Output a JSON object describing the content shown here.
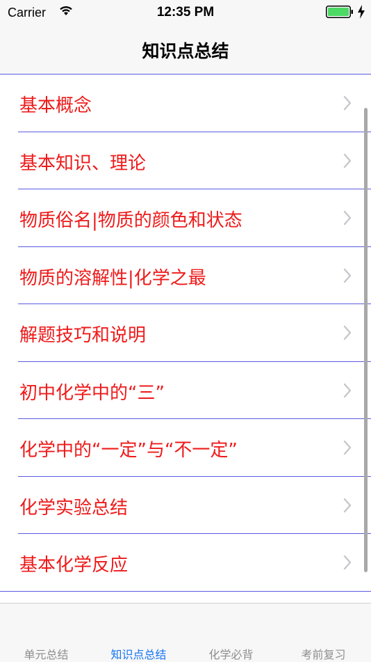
{
  "status_bar": {
    "carrier": "Carrier",
    "time": "12:35 PM"
  },
  "nav": {
    "title": "知识点总结"
  },
  "items": [
    {
      "label": "基本概念"
    },
    {
      "label": "基本知识、理论"
    },
    {
      "label": "物质俗名|物质的颜色和状态"
    },
    {
      "label": "物质的溶解性|化学之最"
    },
    {
      "label": "解题技巧和说明"
    },
    {
      "label": "初中化学中的“三”"
    },
    {
      "label": "化学中的“一定”与“不一定”"
    },
    {
      "label": "化学实验总结"
    },
    {
      "label": "基本化学反应"
    }
  ],
  "tabs": [
    {
      "label": "单元总结"
    },
    {
      "label": "知识点总结"
    },
    {
      "label": "化学必背"
    },
    {
      "label": "考前复习"
    }
  ],
  "colors": {
    "item_text": "#ee1a1a",
    "separator": "#5a5ae0",
    "tab_active": "#1575f5",
    "tab_inactive": "#8e8e8e",
    "battery": "#4cd964"
  },
  "icons": {
    "wifi": "wifi-icon",
    "battery": "battery-icon",
    "charging": "charging-bolt-icon",
    "disclosure": "chevron-right-icon"
  },
  "active_tab_index": 1
}
